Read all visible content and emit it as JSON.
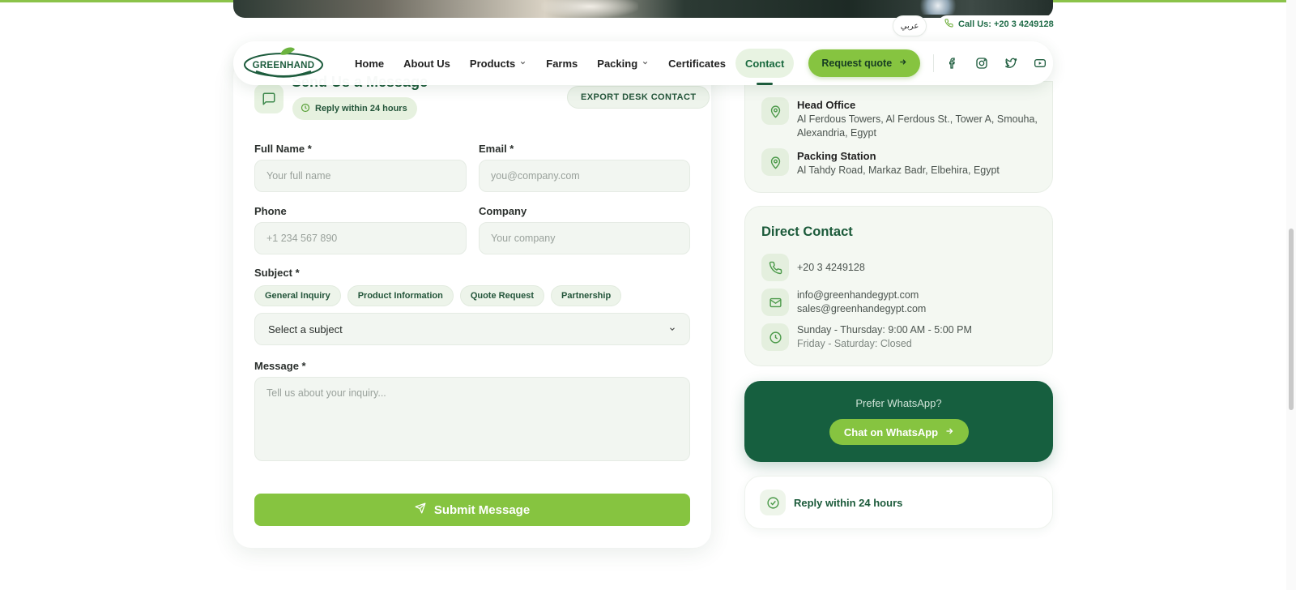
{
  "colors": {
    "brand_dark": "#1b5a3a",
    "brand_green": "#86c440",
    "whatsapp_card": "#165f3f",
    "accent_bar": "#8bc34a"
  },
  "topbar": {
    "lang_label": "عربي",
    "call_label": "Call Us: +20 3 4249128",
    "call_icon": "phone-icon"
  },
  "nav": {
    "logo_text": "GREENHAND",
    "items": [
      {
        "label": "Home"
      },
      {
        "label": "About Us"
      },
      {
        "label": "Products",
        "has_dropdown": true
      },
      {
        "label": "Farms"
      },
      {
        "label": "Packing",
        "has_dropdown": true
      },
      {
        "label": "Certificates"
      },
      {
        "label": "Contact",
        "active": true
      }
    ],
    "quote_button": "Request quote",
    "social_icons": [
      "facebook-icon",
      "instagram-icon",
      "twitter-icon",
      "youtube-icon"
    ]
  },
  "form": {
    "title": "Send Us a Message",
    "reply_badge": "Reply within 24 hours",
    "export_button": "EXPORT DESK CONTACT",
    "full_name": {
      "label": "Full Name *",
      "placeholder": "Your full name"
    },
    "email": {
      "label": "Email *",
      "placeholder": "you@company.com"
    },
    "phone": {
      "label": "Phone",
      "placeholder": "+1 234 567 890"
    },
    "company": {
      "label": "Company",
      "placeholder": "Your company"
    },
    "subject": {
      "label": "Subject *",
      "chips": [
        "General Inquiry",
        "Product Information",
        "Quote Request",
        "Partnership"
      ],
      "select_value": "Select a subject"
    },
    "message": {
      "label": "Message *",
      "placeholder": "Tell us about your inquiry..."
    },
    "submit_label": "Submit Message"
  },
  "locations": [
    {
      "title": "Head Office",
      "lines": [
        "Al Ferdous Towers, Al Ferdous St., Tower A, Smouha,",
        "Alexandria, Egypt"
      ],
      "icon": "map-pin-icon"
    },
    {
      "title": "Packing Station",
      "lines": [
        "Al Tahdy Road, Markaz Badr, Elbehira, Egypt"
      ],
      "icon": "map-pin-icon"
    }
  ],
  "direct_contact": {
    "heading": "Direct Contact",
    "phone": "+20 3 4249128",
    "emails": [
      "info@greenhandegypt.com",
      "sales@greenhandegypt.com"
    ],
    "hours": "Sunday - Thursday: 9:00 AM - 5:00 PM",
    "closed": "Friday - Saturday: Closed"
  },
  "whatsapp": {
    "prompt": "Prefer WhatsApp?",
    "button": "Chat on WhatsApp"
  },
  "reply_card": {
    "text": "Reply within 24 hours"
  }
}
